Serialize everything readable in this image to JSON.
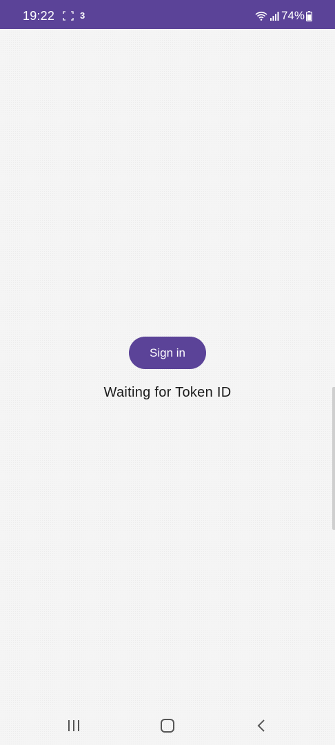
{
  "status_bar": {
    "time": "19:22",
    "notification_glyph": "3",
    "battery_percent": "74%",
    "background_color": "#5b4398",
    "icons": [
      "focus-frame-icon",
      "notification-icon",
      "wifi-icon",
      "signal-icon",
      "battery-icon"
    ]
  },
  "main": {
    "signin_label": "Sign in",
    "status_message": "Waiting for Token ID",
    "accent_color": "#5b4398"
  },
  "nav_bar": {
    "icons": [
      "recents-icon",
      "home-icon",
      "back-icon"
    ]
  }
}
